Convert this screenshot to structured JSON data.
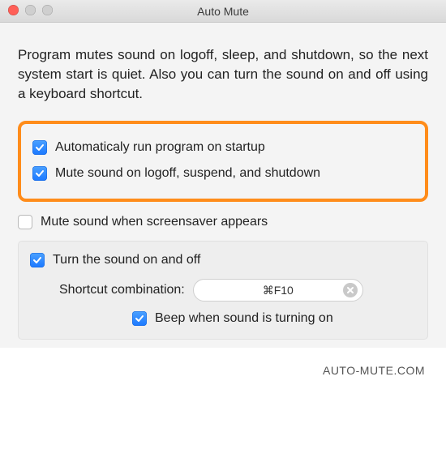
{
  "window": {
    "title": "Auto Mute"
  },
  "description": "Program mutes sound on logoff, sleep, and shutdown, so the next system start is quiet. Also you can turn the sound on and off using a keyboard shortcut.",
  "options": {
    "run_on_startup": {
      "label": "Automaticaly run program on startup",
      "checked": true
    },
    "mute_on_logoff": {
      "label": "Mute sound on logoff, suspend, and shutdown",
      "checked": true
    },
    "mute_on_screensaver": {
      "label": "Mute sound when screensaver appears",
      "checked": false
    }
  },
  "shortcut_panel": {
    "toggle": {
      "label": "Turn the sound on and off",
      "checked": true
    },
    "combo_label": "Shortcut combination:",
    "combo_value": "⌘F10",
    "beep": {
      "label": "Beep when sound is turning on",
      "checked": true
    }
  },
  "footer": "AUTO-MUTE.COM"
}
